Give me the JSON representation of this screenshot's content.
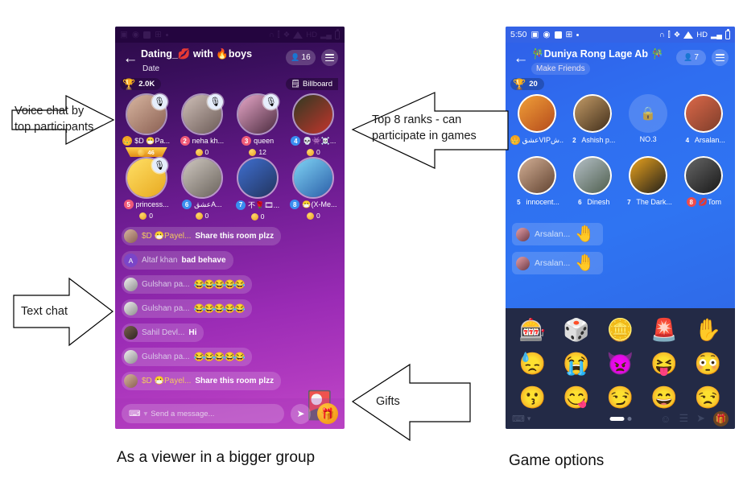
{
  "annotations": [
    {
      "id": "voice-chat",
      "text": "Voice chat by\ntop participants",
      "direction": "right"
    },
    {
      "id": "top-ranks",
      "text": "Top 8 ranks - can\nparticipate in games",
      "direction": "left"
    },
    {
      "id": "text-chat",
      "text": "Text chat",
      "direction": "right"
    },
    {
      "id": "gifts",
      "text": "Gifts",
      "direction": "left"
    }
  ],
  "captions": {
    "left": "As a viewer in a bigger group",
    "right": "Game options"
  },
  "left_phone": {
    "status_bar": {
      "icons": [
        "image-icon",
        "location-icon",
        "square-icon",
        "grid-icon",
        "dot-icon"
      ],
      "right_icons": [
        "headset-icon",
        "vibrate-icon",
        "bluetooth-icon",
        "wifi-icon",
        "hd-icon",
        "signal-icon",
        "battery-icon"
      ]
    },
    "header": {
      "back_icon": "back-arrow-icon",
      "title": "Dating_💋 with 🔥boys",
      "subtitle": "Date",
      "viewer_count": "16",
      "viewer_icon": "person-icon",
      "menu_icon": "hamburger-icon"
    },
    "meta": {
      "trophy_icon": "trophy-icon",
      "trophy_value": "2.0K",
      "billboard_icon": "billboard-icon",
      "billboard_label": "Billboard"
    },
    "seats": [
      {
        "rank": "",
        "rank_color": "#f0a220",
        "name": "$D 😷Pa...",
        "gift": "",
        "banner": "46",
        "avatar": "av-girl1",
        "mic": true,
        "badge_icon": "crown-icon"
      },
      {
        "rank": "2",
        "rank_color": "#ef5a78",
        "name": "neha kh...",
        "gift": "0",
        "banner": "",
        "avatar": "av-girl2",
        "mic": true
      },
      {
        "rank": "3",
        "rank_color": "#ef5a78",
        "name": "queen",
        "gift": "12",
        "banner": "",
        "avatar": "av-girl3",
        "mic": true
      },
      {
        "rank": "4",
        "rank_color": "#3a8ef0",
        "name": "💀👾☠️...",
        "gift": "0",
        "banner": "",
        "avatar": "av-man1",
        "mic": false
      },
      {
        "rank": "5",
        "rank_color": "#ef5a78",
        "name": "princess...",
        "gift": "0",
        "banner": "",
        "avatar": "av-emoji",
        "mic": true
      },
      {
        "rank": "6",
        "rank_color": "#3a8ef0",
        "name": "عشقA...",
        "gift": "0",
        "banner": "",
        "avatar": "av-couple",
        "mic": false
      },
      {
        "rank": "7",
        "rank_color": "#3a8ef0",
        "name": "不🌹🎞...",
        "gift": "0",
        "banner": "",
        "avatar": "av-boy",
        "mic": false
      },
      {
        "rank": "8",
        "rank_color": "#3a8ef0",
        "name": "😷(X-Me...",
        "gift": "0",
        "banner": "",
        "avatar": "av-anime",
        "mic": false
      }
    ],
    "chat": [
      {
        "avatar": "av-girl1",
        "name": "$D 😷Payel...",
        "name_gold": true,
        "text": "Share this room plzz",
        "emojis": ""
      },
      {
        "avatar": "letter-A",
        "name": "Altaf khan",
        "name_gold": false,
        "text": "bad behave",
        "emojis": ""
      },
      {
        "avatar": "av-gulshan",
        "name": "Gulshan pa...",
        "name_gold": false,
        "text": "",
        "emojis": "😂😂😂😂😂"
      },
      {
        "avatar": "av-gulshan",
        "name": "Gulshan pa...",
        "name_gold": false,
        "text": "",
        "emojis": "😂😂😂😂😂"
      },
      {
        "avatar": "av-sahil",
        "name": "Sahil Devl...",
        "name_gold": false,
        "text": "Hi",
        "emojis": ""
      },
      {
        "avatar": "av-gulshan",
        "name": "Gulshan pa...",
        "name_gold": false,
        "text": "",
        "emojis": "😂😂😂😂😂"
      },
      {
        "avatar": "av-girl1",
        "name": "$D 😷Payel...",
        "name_gold": true,
        "text": "Share this room plzz",
        "emojis": ""
      }
    ],
    "floating_gift_icon": "gift-card-icon",
    "bottom_bar": {
      "keyboard_icon": "keyboard-icon",
      "input_placeholder": "Send a message...",
      "send_icon": "send-arrow-icon",
      "gift_icon": "gift-icon"
    }
  },
  "right_phone": {
    "status_bar": {
      "time": "5:50",
      "icons": [
        "image-icon",
        "location-icon",
        "square-icon",
        "grid-icon",
        "dot-icon"
      ],
      "right_icons": [
        "headset-icon",
        "vibrate-icon",
        "bluetooth-icon",
        "wifi-icon",
        "hd-icon",
        "signal-icon",
        "battery-icon"
      ]
    },
    "header": {
      "back_icon": "back-arrow-icon",
      "title": "🎋Duniya Rong Lage Ab 🎋",
      "subtitle": "Make Friends",
      "viewer_count": "7",
      "viewer_icon": "person-icon",
      "menu_icon": "hamburger-icon"
    },
    "meta": {
      "trophy_icon": "trophy-icon",
      "trophy_value": "20"
    },
    "seats": [
      {
        "rank": "",
        "rank_color": "#f0a220",
        "name": "عشقVIPش...",
        "locked": false,
        "avatar": "av-r1",
        "badge_icon": "crown-icon"
      },
      {
        "rank": "2",
        "rank_color": "transparent",
        "name": "Ashish p...",
        "locked": false,
        "avatar": "av-r2"
      },
      {
        "rank": "",
        "rank_color": "transparent",
        "name": "NO.3",
        "locked": true,
        "avatar": ""
      },
      {
        "rank": "4",
        "rank_color": "transparent",
        "name": "Arsalan...",
        "locked": false,
        "avatar": "av-r4"
      },
      {
        "rank": "5",
        "rank_color": "transparent",
        "name": "innocent...",
        "locked": false,
        "avatar": "av-r5"
      },
      {
        "rank": "6",
        "rank_color": "transparent",
        "name": "Dinesh",
        "locked": false,
        "avatar": "av-r6"
      },
      {
        "rank": "7",
        "rank_color": "transparent",
        "name": "The Dark...",
        "locked": false,
        "avatar": "av-r7"
      },
      {
        "rank": "8",
        "rank_color": "#ef4b4b",
        "name": "💋Tom",
        "locked": false,
        "avatar": "av-r8"
      }
    ],
    "chat": [
      {
        "avatar": "av-arsalan",
        "name": "Arsalan...",
        "emoji": "🤚"
      },
      {
        "avatar": "av-arsalan",
        "name": "Arsalan...",
        "emoji": "🤚"
      }
    ],
    "game_panel": {
      "items": [
        "🎰",
        "🎲",
        "🪙",
        "🚨",
        "✋",
        "😓",
        "😭",
        "👿",
        "😝",
        "😳",
        "😗",
        "😋",
        "😏",
        "😄",
        "😒"
      ],
      "footer": {
        "keyboard_icon": "keyboard-icon",
        "page_current": 1,
        "page_total": 2,
        "emoji_icon": "emoji-icon",
        "list_icon": "list-icon",
        "send_icon": "send-arrow-icon",
        "gift_icon": "gift-icon"
      }
    }
  }
}
